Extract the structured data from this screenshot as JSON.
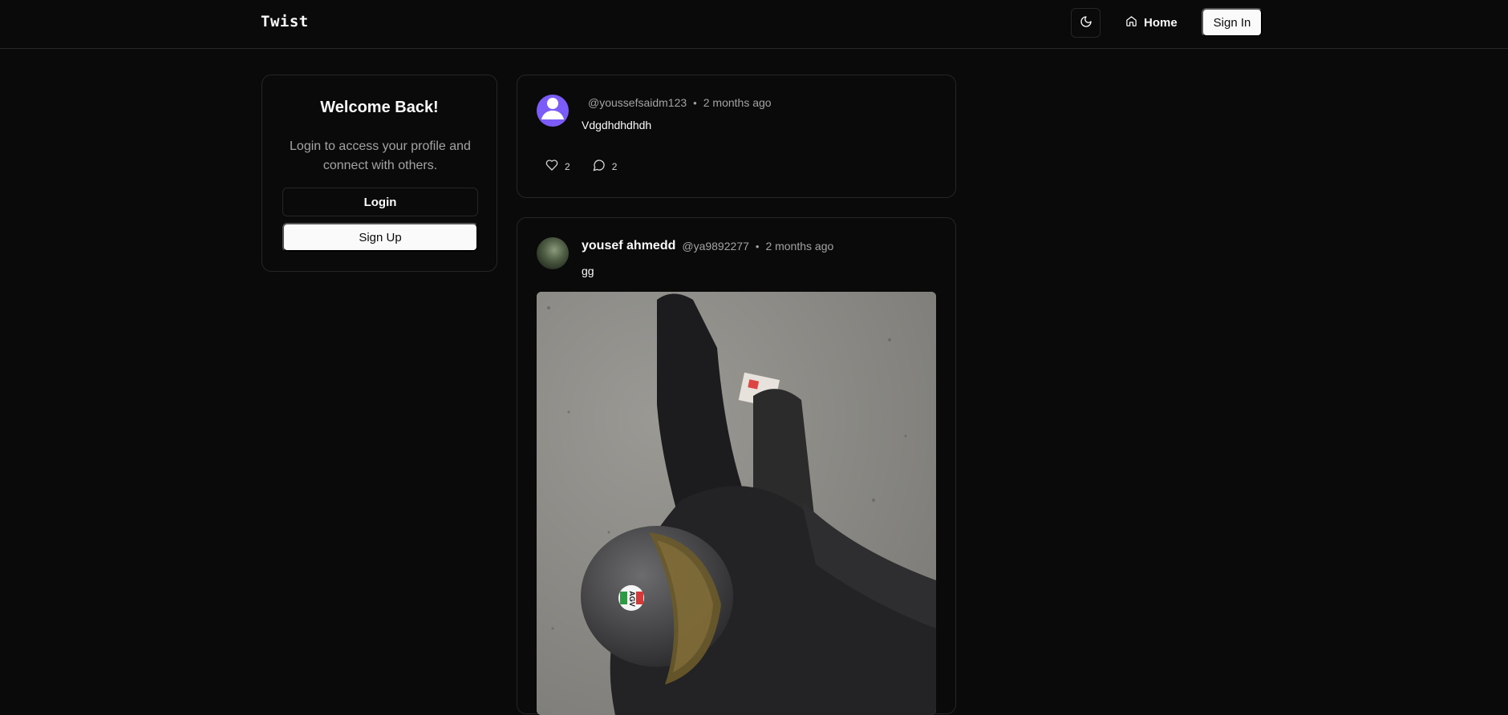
{
  "header": {
    "brand": "Twist",
    "theme_toggle_icon": "moon-icon",
    "home_label": "Home",
    "home_icon": "house-icon",
    "signin_label": "Sign In"
  },
  "welcome": {
    "title": "Welcome Back!",
    "description": "Login to access your profile and connect with others.",
    "login_label": "Login",
    "signup_label": "Sign Up"
  },
  "posts": [
    {
      "author_name": "",
      "handle": "@youssefsaidm123",
      "separator": "•",
      "time": "2 months ago",
      "content": "Vdgdhdhdhdh",
      "likes": "2",
      "comments": "2",
      "avatar_icon": "default-user-icon"
    },
    {
      "author_name": "yousef ahmedd",
      "handle": "@ya9892277",
      "separator": "•",
      "time": "2 months ago",
      "content": "gg",
      "image_description": "photo of a rider in a black hoodie wearing a helmet",
      "image_helmet_logo": "AGV"
    }
  ],
  "colors": {
    "background": "#0a0a0a",
    "border": "#262626",
    "foreground": "#fafafa",
    "muted": "#a3a3a3",
    "avatar_default": "#7c5cf7"
  }
}
